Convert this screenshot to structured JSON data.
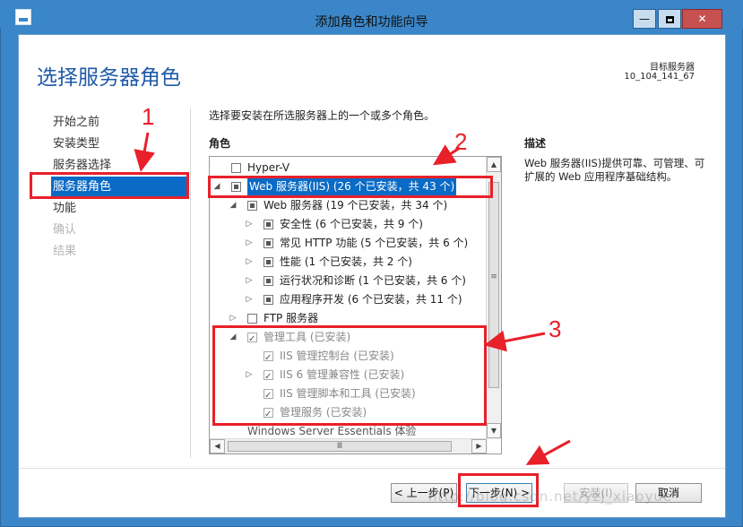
{
  "window": {
    "title": "添加角色和功能向导",
    "minimize": "—",
    "close": "✕"
  },
  "header": {
    "heading": "选择服务器角色",
    "target_label": "目标服务器",
    "target_value": "10_104_141_67"
  },
  "nav": {
    "items": [
      {
        "label": "开始之前",
        "state": "normal"
      },
      {
        "label": "安装类型",
        "state": "normal"
      },
      {
        "label": "服务器选择",
        "state": "normal"
      },
      {
        "label": "服务器角色",
        "state": "active"
      },
      {
        "label": "功能",
        "state": "normal"
      },
      {
        "label": "确认",
        "state": "disabled"
      },
      {
        "label": "结果",
        "state": "disabled"
      }
    ]
  },
  "main": {
    "instruction": "选择要安装在所选服务器上的一个或多个角色。",
    "roles_label": "角色",
    "description_label": "描述",
    "description_text": "Web 服务器(IIS)提供可靠、可管理、可扩展的 Web 应用程序基础结构。"
  },
  "roles_tree": [
    {
      "label": "Hyper-V",
      "checkbox": "unchecked",
      "expander": ""
    },
    {
      "label": "Web 服务器(IIS) (26 个已安装，共 43 个)",
      "checkbox": "partial",
      "expander": "◢"
    },
    {
      "label": "Web 服务器 (19 个已安装，共 34 个)",
      "checkbox": "partial",
      "expander": "◢"
    },
    {
      "label": "安全性 (6 个已安装，共 9 个)",
      "checkbox": "partial",
      "expander": "▷"
    },
    {
      "label": "常见 HTTP 功能 (5 个已安装，共 6 个)",
      "checkbox": "partial",
      "expander": "▷"
    },
    {
      "label": "性能 (1 个已安装，共 2 个)",
      "checkbox": "partial",
      "expander": "▷"
    },
    {
      "label": "运行状况和诊断 (1 个已安装，共 6 个)",
      "checkbox": "partial",
      "expander": "▷"
    },
    {
      "label": "应用程序开发 (6 个已安装，共 11 个)",
      "checkbox": "partial",
      "expander": "▷"
    },
    {
      "label": "FTP 服务器",
      "checkbox": "unchecked",
      "expander": "▷"
    },
    {
      "label": "管理工具 (已安装)",
      "checkbox": "checked",
      "expander": "◢"
    },
    {
      "label": "IIS 管理控制台 (已安装)",
      "checkbox": "checked",
      "expander": ""
    },
    {
      "label": "IIS 6 管理兼容性 (已安装)",
      "checkbox": "checked",
      "expander": "▷"
    },
    {
      "label": "IIS 管理脚本和工具 (已安装)",
      "checkbox": "checked",
      "expander": ""
    },
    {
      "label": "管理服务 (已安装)",
      "checkbox": "checked",
      "expander": ""
    },
    {
      "label": "Windows Server Essentials 体验",
      "checkbox": "unchecked",
      "expander": ""
    }
  ],
  "scrollbar": {
    "up": "▲",
    "down": "▼",
    "left": "◀",
    "right": "▶",
    "grip_v": "≡",
    "grip_h": "Ⅲ"
  },
  "buttons": {
    "prev": "< 上一步(P)",
    "next": "下一步(N) >",
    "install": "安装(I)",
    "cancel": "取消"
  },
  "annotations": {
    "n1": "1",
    "n2": "2",
    "n3": "3",
    "color": "#e8202a"
  },
  "watermark": "http://blog.csdn.net/yzj_xiaoyue",
  "colors": {
    "accent": "#0a6bc6",
    "titlebar": "#3a86c8",
    "heading": "#1e5aa8"
  }
}
